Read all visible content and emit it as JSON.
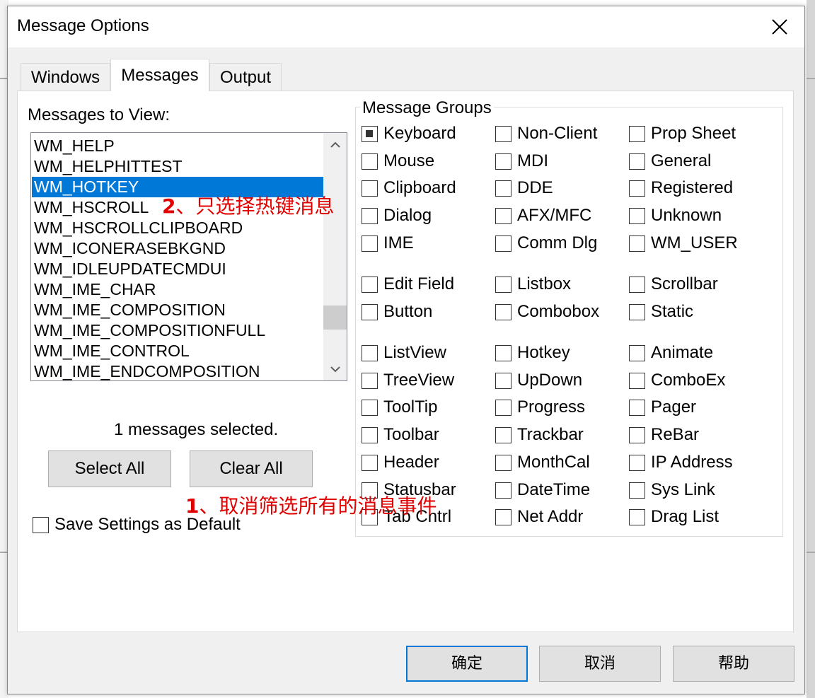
{
  "dialog": {
    "title": "Message Options"
  },
  "tabs": [
    {
      "label": "Windows",
      "active": false
    },
    {
      "label": "Messages",
      "active": true
    },
    {
      "label": "Output",
      "active": false
    }
  ],
  "messages_panel": {
    "label": "Messages to View:",
    "items": [
      "WM_HELP",
      "WM_HELPHITTEST",
      "WM_HOTKEY",
      "WM_HSCROLL",
      "WM_HSCROLLCLIPBOARD",
      "WM_ICONERASEBKGND",
      "WM_IDLEUPDATECMDUI",
      "WM_IME_CHAR",
      "WM_IME_COMPOSITION",
      "WM_IME_COMPOSITIONFULL",
      "WM_IME_CONTROL",
      "WM_IME_ENDCOMPOSITION"
    ],
    "selected_index": 2,
    "selection_count": "1  messages selected.",
    "select_all_label": "Select All",
    "clear_all_label": "Clear All",
    "save_default_label": "Save Settings as Default",
    "save_default_checked": false
  },
  "groups": {
    "label": "Message Groups",
    "rows": [
      [
        {
          "label": "Keyboard",
          "checked": true
        },
        {
          "label": "Non-Client",
          "checked": false
        },
        {
          "label": "Prop Sheet",
          "checked": false
        }
      ],
      [
        {
          "label": "Mouse",
          "checked": false
        },
        {
          "label": "MDI",
          "checked": false
        },
        {
          "label": "General",
          "checked": false
        }
      ],
      [
        {
          "label": "Clipboard",
          "checked": false
        },
        {
          "label": "DDE",
          "checked": false
        },
        {
          "label": "Registered",
          "checked": false
        }
      ],
      [
        {
          "label": "Dialog",
          "checked": false
        },
        {
          "label": "AFX/MFC",
          "checked": false
        },
        {
          "label": "Unknown",
          "checked": false
        }
      ],
      [
        {
          "label": "IME",
          "checked": false
        },
        {
          "label": "Comm Dlg",
          "checked": false
        },
        {
          "label": "WM_USER",
          "checked": false
        }
      ],
      [
        {
          "label": "Edit Field",
          "checked": false
        },
        {
          "label": "Listbox",
          "checked": false
        },
        {
          "label": "Scrollbar",
          "checked": false
        }
      ],
      [
        {
          "label": "Button",
          "checked": false
        },
        {
          "label": "Combobox",
          "checked": false
        },
        {
          "label": "Static",
          "checked": false
        }
      ],
      [
        {
          "label": "ListView",
          "checked": false
        },
        {
          "label": "Hotkey",
          "checked": false
        },
        {
          "label": "Animate",
          "checked": false
        }
      ],
      [
        {
          "label": "TreeView",
          "checked": false
        },
        {
          "label": "UpDown",
          "checked": false
        },
        {
          "label": "ComboEx",
          "checked": false
        }
      ],
      [
        {
          "label": "ToolTip",
          "checked": false
        },
        {
          "label": "Progress",
          "checked": false
        },
        {
          "label": "Pager",
          "checked": false
        }
      ],
      [
        {
          "label": "Toolbar",
          "checked": false
        },
        {
          "label": "Trackbar",
          "checked": false
        },
        {
          "label": "ReBar",
          "checked": false
        }
      ],
      [
        {
          "label": "Header",
          "checked": false
        },
        {
          "label": "MonthCal",
          "checked": false
        },
        {
          "label": "IP Address",
          "checked": false
        }
      ],
      [
        {
          "label": "Statusbar",
          "checked": false
        },
        {
          "label": "DateTime",
          "checked": false
        },
        {
          "label": "Sys Link",
          "checked": false
        }
      ],
      [
        {
          "label": "Tab Cntrl",
          "checked": false
        },
        {
          "label": "Net Addr",
          "checked": false
        },
        {
          "label": "Drag List",
          "checked": false
        }
      ]
    ]
  },
  "annotations": {
    "step1_num": "1",
    "step1_text": "、取消筛选所有的消息事件",
    "step2_num": "2",
    "step2_text": "、只选择热键消息"
  },
  "dialog_buttons": {
    "ok": "确定",
    "cancel": "取消",
    "help": "帮助"
  },
  "colors": {
    "selection": "#0078d7",
    "annotation": "#e00000",
    "default_button_border": "#0078d7"
  }
}
